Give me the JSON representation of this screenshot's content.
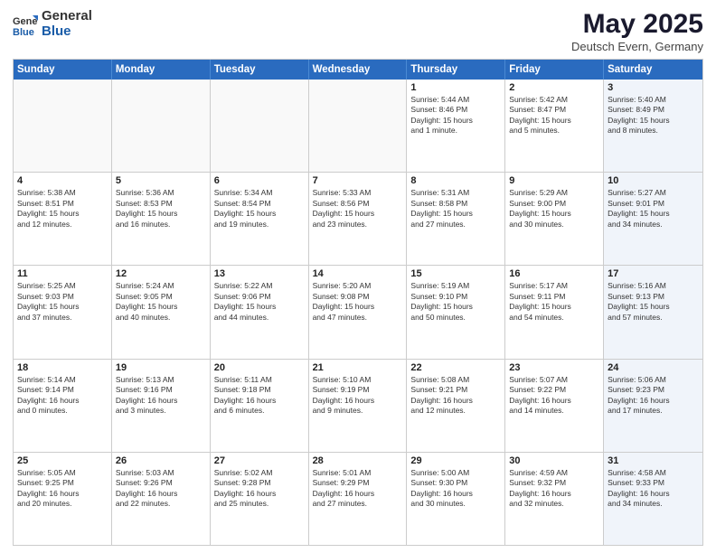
{
  "header": {
    "logo_general": "General",
    "logo_blue": "Blue",
    "month_title": "May 2025",
    "location": "Deutsch Evern, Germany"
  },
  "day_headers": [
    "Sunday",
    "Monday",
    "Tuesday",
    "Wednesday",
    "Thursday",
    "Friday",
    "Saturday"
  ],
  "weeks": [
    [
      {
        "num": "",
        "info": "",
        "empty": true
      },
      {
        "num": "",
        "info": "",
        "empty": true
      },
      {
        "num": "",
        "info": "",
        "empty": true
      },
      {
        "num": "",
        "info": "",
        "empty": true
      },
      {
        "num": "1",
        "info": "Sunrise: 5:44 AM\nSunset: 8:46 PM\nDaylight: 15 hours\nand 1 minute.",
        "empty": false
      },
      {
        "num": "2",
        "info": "Sunrise: 5:42 AM\nSunset: 8:47 PM\nDaylight: 15 hours\nand 5 minutes.",
        "empty": false
      },
      {
        "num": "3",
        "info": "Sunrise: 5:40 AM\nSunset: 8:49 PM\nDaylight: 15 hours\nand 8 minutes.",
        "empty": false,
        "shaded": true
      }
    ],
    [
      {
        "num": "4",
        "info": "Sunrise: 5:38 AM\nSunset: 8:51 PM\nDaylight: 15 hours\nand 12 minutes.",
        "empty": false
      },
      {
        "num": "5",
        "info": "Sunrise: 5:36 AM\nSunset: 8:53 PM\nDaylight: 15 hours\nand 16 minutes.",
        "empty": false
      },
      {
        "num": "6",
        "info": "Sunrise: 5:34 AM\nSunset: 8:54 PM\nDaylight: 15 hours\nand 19 minutes.",
        "empty": false
      },
      {
        "num": "7",
        "info": "Sunrise: 5:33 AM\nSunset: 8:56 PM\nDaylight: 15 hours\nand 23 minutes.",
        "empty": false
      },
      {
        "num": "8",
        "info": "Sunrise: 5:31 AM\nSunset: 8:58 PM\nDaylight: 15 hours\nand 27 minutes.",
        "empty": false
      },
      {
        "num": "9",
        "info": "Sunrise: 5:29 AM\nSunset: 9:00 PM\nDaylight: 15 hours\nand 30 minutes.",
        "empty": false
      },
      {
        "num": "10",
        "info": "Sunrise: 5:27 AM\nSunset: 9:01 PM\nDaylight: 15 hours\nand 34 minutes.",
        "empty": false,
        "shaded": true
      }
    ],
    [
      {
        "num": "11",
        "info": "Sunrise: 5:25 AM\nSunset: 9:03 PM\nDaylight: 15 hours\nand 37 minutes.",
        "empty": false
      },
      {
        "num": "12",
        "info": "Sunrise: 5:24 AM\nSunset: 9:05 PM\nDaylight: 15 hours\nand 40 minutes.",
        "empty": false
      },
      {
        "num": "13",
        "info": "Sunrise: 5:22 AM\nSunset: 9:06 PM\nDaylight: 15 hours\nand 44 minutes.",
        "empty": false
      },
      {
        "num": "14",
        "info": "Sunrise: 5:20 AM\nSunset: 9:08 PM\nDaylight: 15 hours\nand 47 minutes.",
        "empty": false
      },
      {
        "num": "15",
        "info": "Sunrise: 5:19 AM\nSunset: 9:10 PM\nDaylight: 15 hours\nand 50 minutes.",
        "empty": false
      },
      {
        "num": "16",
        "info": "Sunrise: 5:17 AM\nSunset: 9:11 PM\nDaylight: 15 hours\nand 54 minutes.",
        "empty": false
      },
      {
        "num": "17",
        "info": "Sunrise: 5:16 AM\nSunset: 9:13 PM\nDaylight: 15 hours\nand 57 minutes.",
        "empty": false,
        "shaded": true
      }
    ],
    [
      {
        "num": "18",
        "info": "Sunrise: 5:14 AM\nSunset: 9:14 PM\nDaylight: 16 hours\nand 0 minutes.",
        "empty": false
      },
      {
        "num": "19",
        "info": "Sunrise: 5:13 AM\nSunset: 9:16 PM\nDaylight: 16 hours\nand 3 minutes.",
        "empty": false
      },
      {
        "num": "20",
        "info": "Sunrise: 5:11 AM\nSunset: 9:18 PM\nDaylight: 16 hours\nand 6 minutes.",
        "empty": false
      },
      {
        "num": "21",
        "info": "Sunrise: 5:10 AM\nSunset: 9:19 PM\nDaylight: 16 hours\nand 9 minutes.",
        "empty": false
      },
      {
        "num": "22",
        "info": "Sunrise: 5:08 AM\nSunset: 9:21 PM\nDaylight: 16 hours\nand 12 minutes.",
        "empty": false
      },
      {
        "num": "23",
        "info": "Sunrise: 5:07 AM\nSunset: 9:22 PM\nDaylight: 16 hours\nand 14 minutes.",
        "empty": false
      },
      {
        "num": "24",
        "info": "Sunrise: 5:06 AM\nSunset: 9:23 PM\nDaylight: 16 hours\nand 17 minutes.",
        "empty": false,
        "shaded": true
      }
    ],
    [
      {
        "num": "25",
        "info": "Sunrise: 5:05 AM\nSunset: 9:25 PM\nDaylight: 16 hours\nand 20 minutes.",
        "empty": false
      },
      {
        "num": "26",
        "info": "Sunrise: 5:03 AM\nSunset: 9:26 PM\nDaylight: 16 hours\nand 22 minutes.",
        "empty": false
      },
      {
        "num": "27",
        "info": "Sunrise: 5:02 AM\nSunset: 9:28 PM\nDaylight: 16 hours\nand 25 minutes.",
        "empty": false
      },
      {
        "num": "28",
        "info": "Sunrise: 5:01 AM\nSunset: 9:29 PM\nDaylight: 16 hours\nand 27 minutes.",
        "empty": false
      },
      {
        "num": "29",
        "info": "Sunrise: 5:00 AM\nSunset: 9:30 PM\nDaylight: 16 hours\nand 30 minutes.",
        "empty": false
      },
      {
        "num": "30",
        "info": "Sunrise: 4:59 AM\nSunset: 9:32 PM\nDaylight: 16 hours\nand 32 minutes.",
        "empty": false
      },
      {
        "num": "31",
        "info": "Sunrise: 4:58 AM\nSunset: 9:33 PM\nDaylight: 16 hours\nand 34 minutes.",
        "empty": false,
        "shaded": true
      }
    ]
  ]
}
